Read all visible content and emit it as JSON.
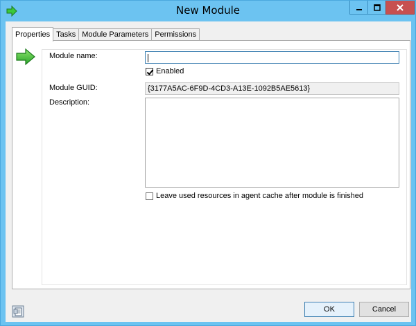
{
  "window": {
    "title": "New Module"
  },
  "tabs": [
    {
      "label": "Properties",
      "active": true
    },
    {
      "label": "Tasks",
      "active": false
    },
    {
      "label": "Module Parameters",
      "active": false
    },
    {
      "label": "Permissions",
      "active": false
    }
  ],
  "form": {
    "module_name_label": "Module name:",
    "module_name_value": "",
    "enabled_label": "Enabled",
    "enabled_checked": true,
    "guid_label": "Module GUID:",
    "guid_value": "{3177A5AC-6F9D-4CD3-A13E-1092B5AE5613}",
    "description_label": "Description:",
    "description_value": "",
    "leave_resources_label": "Leave used resources in agent cache after module is finished",
    "leave_resources_checked": false
  },
  "buttons": {
    "ok_label": "OK",
    "cancel_label": "Cancel"
  },
  "icons": {
    "title": "green-arrow-icon",
    "panel": "green-arrow-icon",
    "footer": "document-icon"
  },
  "colors": {
    "titlebar": "#6cc3f1",
    "close_button": "#c75050",
    "arrow_green": "#3cc83c"
  }
}
